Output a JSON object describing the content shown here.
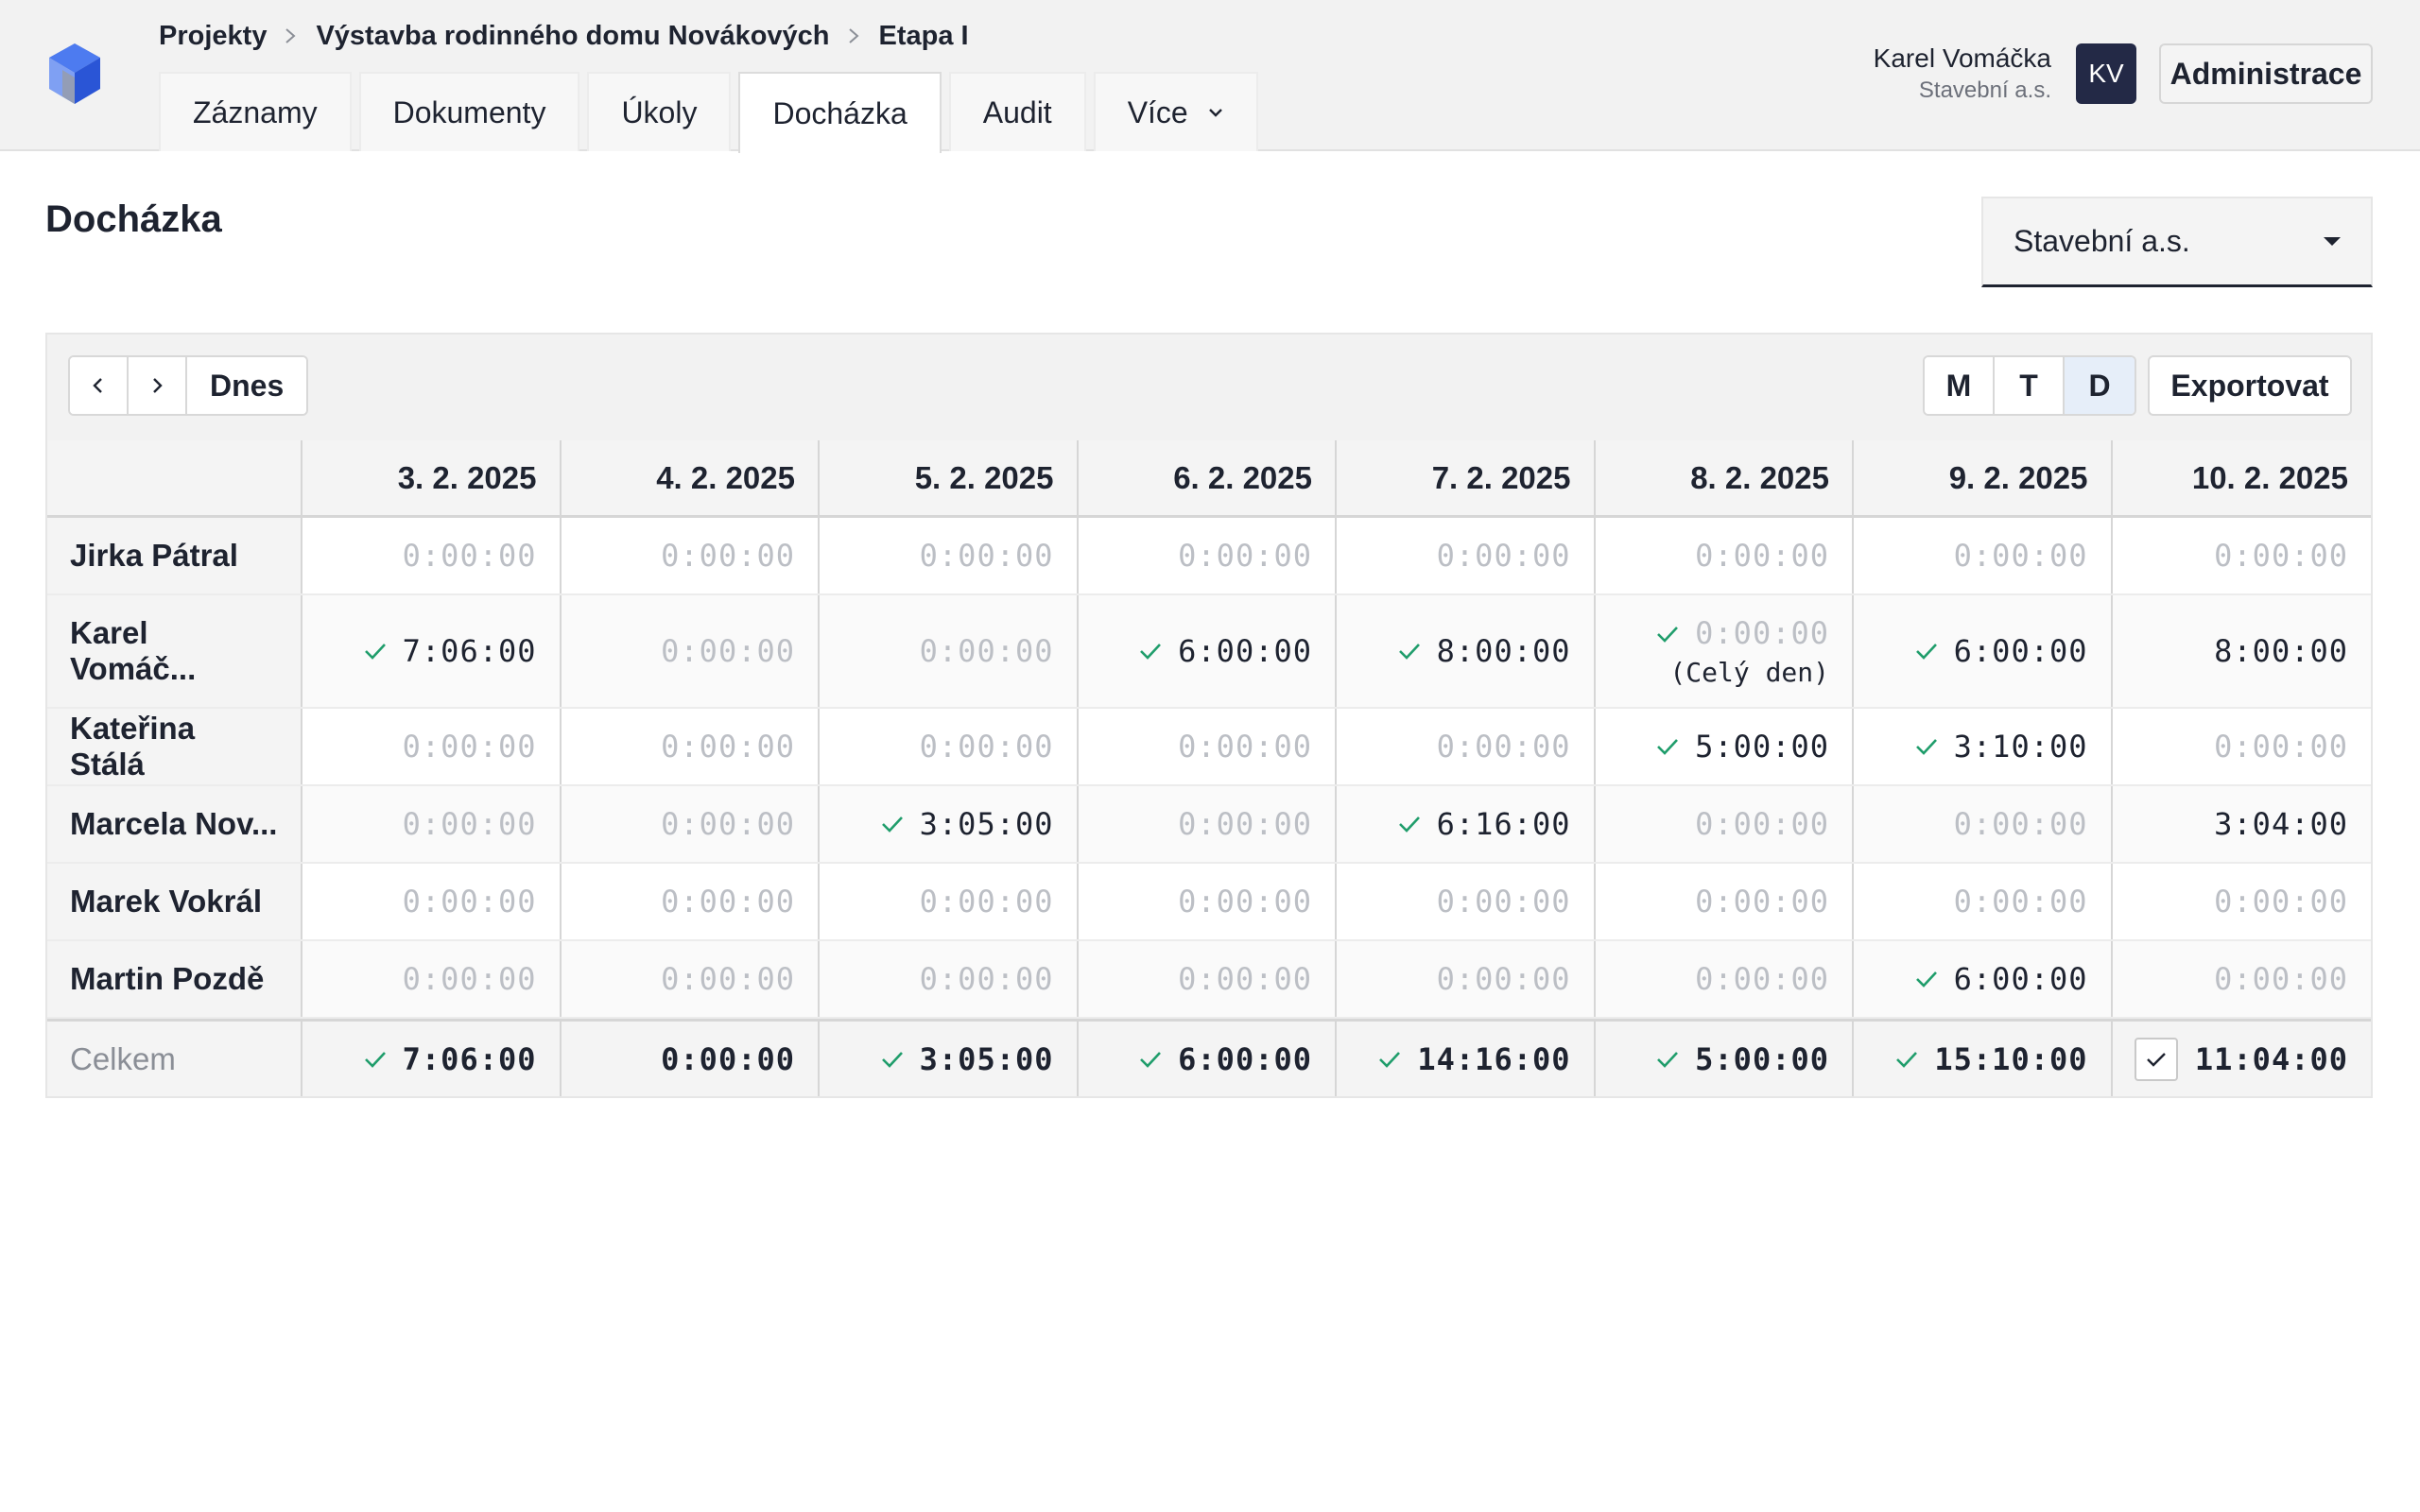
{
  "breadcrumb": [
    "Projekty",
    "Výstavba rodinného domu Novákových",
    "Etapa I"
  ],
  "tabs": [
    "Záznamy",
    "Dokumenty",
    "Úkoly",
    "Docházka",
    "Audit",
    "Více"
  ],
  "active_tab": "Docházka",
  "user": {
    "name": "Karel Vomáčka",
    "company": "Stavební a.s.",
    "initials": "KV"
  },
  "admin_label": "Administrace",
  "page_title": "Docházka",
  "company_select": "Stavební a.s.",
  "toolbar": {
    "prev_icon": "chevron-left-icon",
    "next_icon": "chevron-right-icon",
    "today_label": "Dnes",
    "views": [
      "M",
      "T",
      "D"
    ],
    "active_view": "D",
    "export_label": "Exportovat"
  },
  "dates": [
    "3. 2. 2025",
    "4. 2. 2025",
    "5. 2. 2025",
    "6. 2. 2025",
    "7. 2. 2025",
    "8. 2. 2025",
    "9. 2. 2025",
    "10. 2. 2025"
  ],
  "rows": [
    {
      "name": "Jirka Pátral",
      "cells": [
        {
          "t": "0:00:00"
        },
        {
          "t": "0:00:00"
        },
        {
          "t": "0:00:00"
        },
        {
          "t": "0:00:00"
        },
        {
          "t": "0:00:00"
        },
        {
          "t": "0:00:00"
        },
        {
          "t": "0:00:00"
        },
        {
          "t": "0:00:00"
        }
      ]
    },
    {
      "name": "Karel Vomáč...",
      "cells": [
        {
          "t": "7:06:00",
          "check": true
        },
        {
          "t": "0:00:00"
        },
        {
          "t": "0:00:00"
        },
        {
          "t": "6:00:00",
          "check": true
        },
        {
          "t": "8:00:00",
          "check": true
        },
        {
          "t": "0:00:00",
          "check": true,
          "note": "(Celý den)"
        },
        {
          "t": "6:00:00",
          "check": true
        },
        {
          "t": "8:00:00",
          "plain": true
        }
      ]
    },
    {
      "name": "Kateřina Stálá",
      "cells": [
        {
          "t": "0:00:00"
        },
        {
          "t": "0:00:00"
        },
        {
          "t": "0:00:00"
        },
        {
          "t": "0:00:00"
        },
        {
          "t": "0:00:00"
        },
        {
          "t": "5:00:00",
          "check": true
        },
        {
          "t": "3:10:00",
          "check": true
        },
        {
          "t": "0:00:00"
        }
      ]
    },
    {
      "name": "Marcela Nov...",
      "cells": [
        {
          "t": "0:00:00"
        },
        {
          "t": "0:00:00"
        },
        {
          "t": "3:05:00",
          "check": true
        },
        {
          "t": "0:00:00"
        },
        {
          "t": "6:16:00",
          "check": true
        },
        {
          "t": "0:00:00"
        },
        {
          "t": "0:00:00"
        },
        {
          "t": "3:04:00",
          "plain": true
        }
      ]
    },
    {
      "name": "Marek Vokrál",
      "cells": [
        {
          "t": "0:00:00"
        },
        {
          "t": "0:00:00"
        },
        {
          "t": "0:00:00"
        },
        {
          "t": "0:00:00"
        },
        {
          "t": "0:00:00"
        },
        {
          "t": "0:00:00"
        },
        {
          "t": "0:00:00"
        },
        {
          "t": "0:00:00"
        }
      ]
    },
    {
      "name": "Martin Pozdě",
      "cells": [
        {
          "t": "0:00:00"
        },
        {
          "t": "0:00:00"
        },
        {
          "t": "0:00:00"
        },
        {
          "t": "0:00:00"
        },
        {
          "t": "0:00:00"
        },
        {
          "t": "0:00:00"
        },
        {
          "t": "6:00:00",
          "check": true
        },
        {
          "t": "0:00:00"
        }
      ]
    }
  ],
  "totals": {
    "label": "Celkem",
    "cells": [
      {
        "t": "7:06:00",
        "check": true
      },
      {
        "t": "0:00:00"
      },
      {
        "t": "3:05:00",
        "check": true
      },
      {
        "t": "6:00:00",
        "check": true
      },
      {
        "t": "14:16:00",
        "check": true
      },
      {
        "t": "5:00:00",
        "check": true
      },
      {
        "t": "15:10:00",
        "check": true
      },
      {
        "t": "11:04:00",
        "checkbox": true
      }
    ]
  },
  "colors": {
    "check": "#1f9d6b",
    "avatar_bg": "#232946",
    "active_view_bg": "#e6eef9",
    "zero_text": "#bcbfc5"
  }
}
